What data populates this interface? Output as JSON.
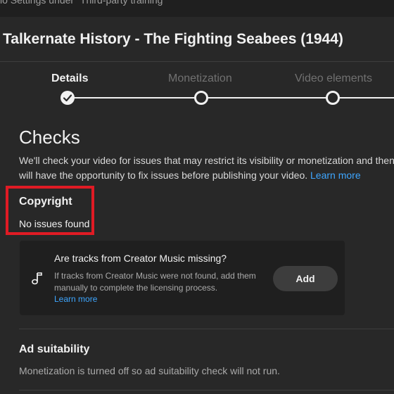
{
  "topbar": {
    "text": "lo Settings under \"Third-party training\""
  },
  "video": {
    "title": "Talkernate History - The Fighting Seabees (1944)"
  },
  "stepper": {
    "steps": [
      {
        "label": "Details",
        "state": "completed"
      },
      {
        "label": "Monetization",
        "state": "pending"
      },
      {
        "label": "Video elements",
        "state": "pending"
      }
    ]
  },
  "checks": {
    "heading": "Checks",
    "description_line1": "We'll check your video for issues that may restrict its visibility or monetization and then you",
    "description_line2": "will have the opportunity to fix issues before publishing your video.",
    "learn_more": "Learn more"
  },
  "copyright": {
    "title": "Copyright",
    "status": "No issues found",
    "highlight_color": "#e01b24"
  },
  "creator_music": {
    "icon": "music-note-icon",
    "title": "Are tracks from Creator Music missing?",
    "body": "If tracks from Creator Music were not found, add them manually to complete the licensing process.",
    "learn_more": "Learn more",
    "add_button": "Add"
  },
  "ad_suitability": {
    "title": "Ad suitability",
    "status": "Monetization is turned off so ad suitability check will not run."
  },
  "colors": {
    "background": "#282828",
    "card": "#1f1f1f",
    "link": "#3ea6ff",
    "text_primary": "#f1f1f1",
    "text_secondary": "#aaaaaa"
  }
}
